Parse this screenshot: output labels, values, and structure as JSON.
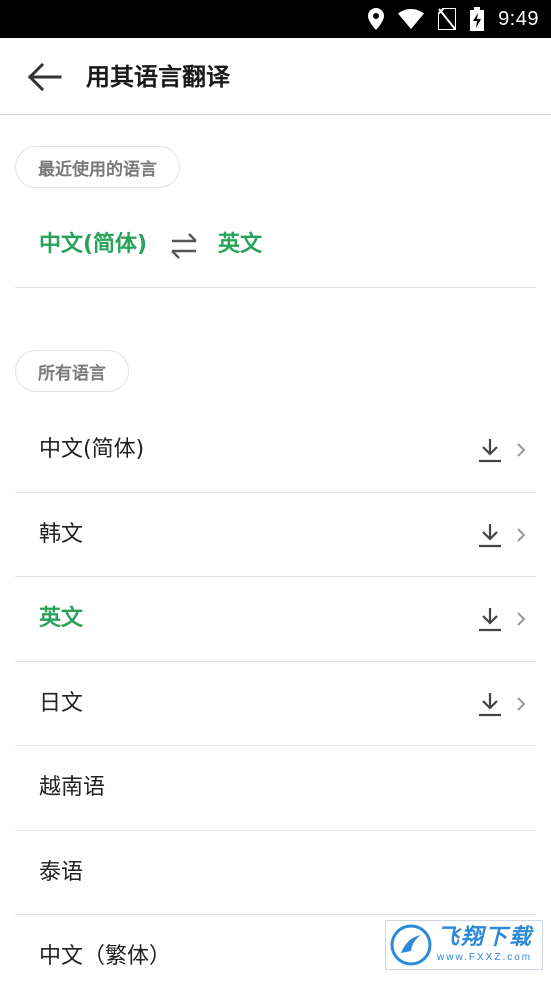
{
  "status_bar": {
    "time": "9:49"
  },
  "header": {
    "title": "用其语言翻译"
  },
  "recent": {
    "chip_label": "最近使用的语言",
    "source_lang": "中文(简体)",
    "target_lang": "英文"
  },
  "all": {
    "chip_label": "所有语言",
    "items": [
      {
        "label": "中文(简体)"
      },
      {
        "label": "韩文"
      },
      {
        "label": "英文"
      },
      {
        "label": "日文"
      },
      {
        "label": "越南语"
      },
      {
        "label": "泰语"
      },
      {
        "label": "中文（繁体）"
      }
    ]
  },
  "watermark": {
    "main": "飞翔下载",
    "sub": "www.FXXZ.com"
  },
  "colors": {
    "accent": "#2aa35a",
    "divider": "#e4e4e4",
    "status_bar": "#000000"
  }
}
